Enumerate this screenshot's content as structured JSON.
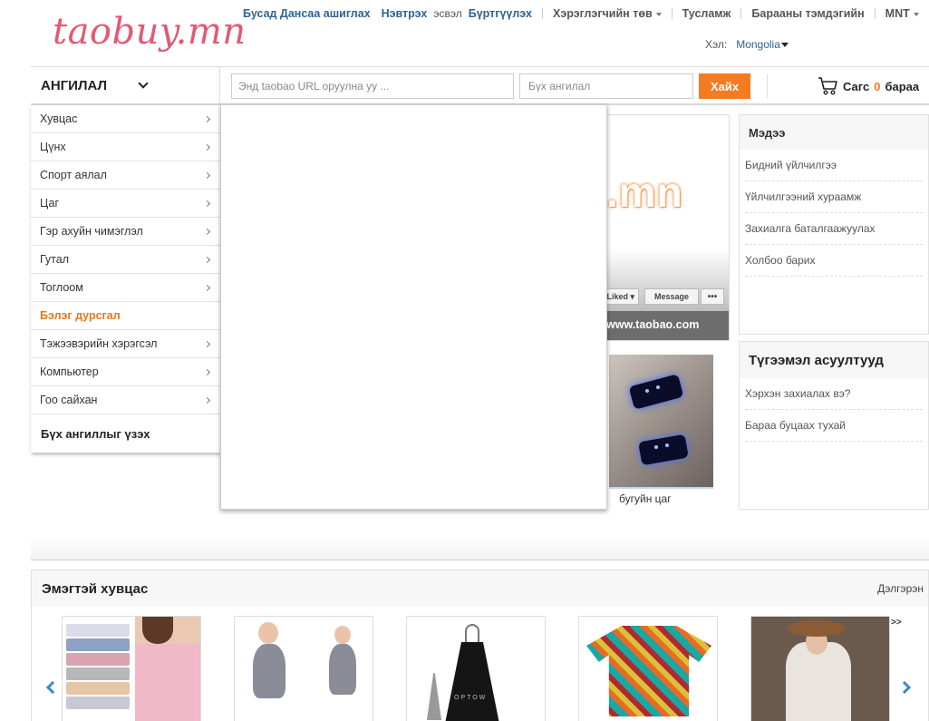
{
  "header": {
    "logo": "taobuy.mn",
    "nav": {
      "browse_other": "Бусад Дансаа ашиглах",
      "login": "Нэвтрэх",
      "or": "эсвэл",
      "register": "Бүртгүүлэх",
      "user_center": "Хэрэглэгчийн төв",
      "help": "Тусламж",
      "track": "Барааны тэмдэгийн",
      "currency": "MNT"
    },
    "language": {
      "label": "Хэл:",
      "value": "Mongolia"
    }
  },
  "searchbar": {
    "category_title": "АНГИЛАЛ",
    "url_placeholder": "Энд taobao URL оруулна уу ...",
    "category_placeholder": "Бүх ангилал",
    "search_button": "Хайх",
    "cart": {
      "label": "Сагс",
      "count": "0",
      "unit": "бараа"
    }
  },
  "categories": {
    "items": [
      {
        "label": "Хувцас",
        "active": false
      },
      {
        "label": "Цүнх",
        "active": false
      },
      {
        "label": "Спорт аялал",
        "active": false
      },
      {
        "label": "Цаг",
        "active": false
      },
      {
        "label": "Гэр ахуйн чимэглэл",
        "active": false
      },
      {
        "label": "Гутал",
        "active": false
      },
      {
        "label": "Тоглоом",
        "active": false
      },
      {
        "label": "Бэлэг дурсгал",
        "active": true
      },
      {
        "label": "Тэжээвэрийн хэрэгсэл",
        "active": false
      },
      {
        "label": "Компьютер",
        "active": false
      },
      {
        "label": "Гоо сайхан",
        "active": false
      }
    ],
    "view_all": "Бүх ангиллыг үзэх"
  },
  "banner": {
    "brand_text": ".mn",
    "url_text": "www.taobao.com",
    "fb_liked": "Liked ▾",
    "fb_message": "Message",
    "fb_more": "•••"
  },
  "featured": {
    "caption": "бугуйн цаг"
  },
  "news": {
    "title": "Мэдээ",
    "items": [
      "Бидний үйлчилгээ",
      "Үйлчилгээний хураамж",
      "Захиалга баталгаажуулах",
      "Холбоо барих"
    ]
  },
  "faq": {
    "title": "Түгээмэл асуултууд",
    "items": [
      "Хэрхэн захиалах вэ?",
      "Бараа буцаах тухай"
    ]
  },
  "section": {
    "title": "Эмэгтэй хувцас",
    "more": "Дэлгэрэн",
    "next_text": ">>",
    "product_brand_text": "OPTOW"
  },
  "colors": {
    "accent_orange": "#f47b20",
    "link_blue": "#2a6496",
    "logo_pink": "#e25a72",
    "active_category": "#e5781b"
  }
}
